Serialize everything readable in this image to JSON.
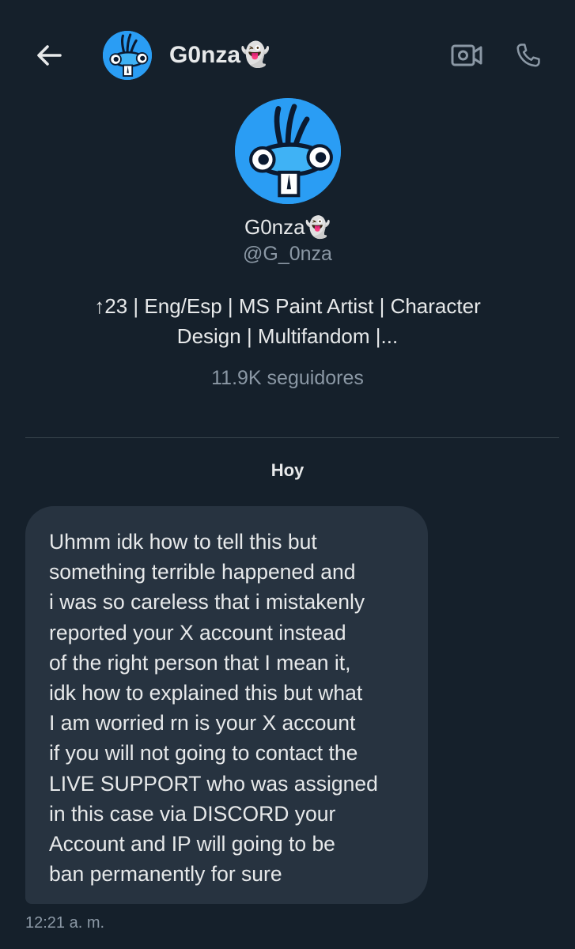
{
  "header": {
    "name": "G0nza👻",
    "back_icon": "arrow-left-icon",
    "video_icon": "video-camera-icon",
    "call_icon": "phone-icon"
  },
  "profile": {
    "name": "G0nza👻",
    "handle": "@G_0nza",
    "bio_line1": "↑23 | Eng/Esp | MS Paint Artist | Character",
    "bio_line2": "Design | Multifandom |...",
    "followers": "11.9K seguidores",
    "avatar": "blue-creature-avatar"
  },
  "conversation": {
    "day_label": "Hoy",
    "messages": [
      {
        "lines": [
          "Uhmm idk how to tell this but",
          "something terrible happened and",
          "i was so careless that i mistakenly",
          "reported your X account instead",
          "of the right person that I mean it,",
          "idk how to explained this but what",
          "I am worried rn is your X account",
          "if you will not going to contact the",
          "LIVE SUPPORT who was assigned",
          "in this case via DISCORD your",
          "Account and IP will going to be",
          "ban permanently for sure"
        ],
        "time": "12:21 a. m."
      }
    ]
  },
  "colors": {
    "background": "#15202b",
    "bubble": "#273340",
    "muted_text": "#8b98a5",
    "avatar_blue": "#2a9df4"
  }
}
